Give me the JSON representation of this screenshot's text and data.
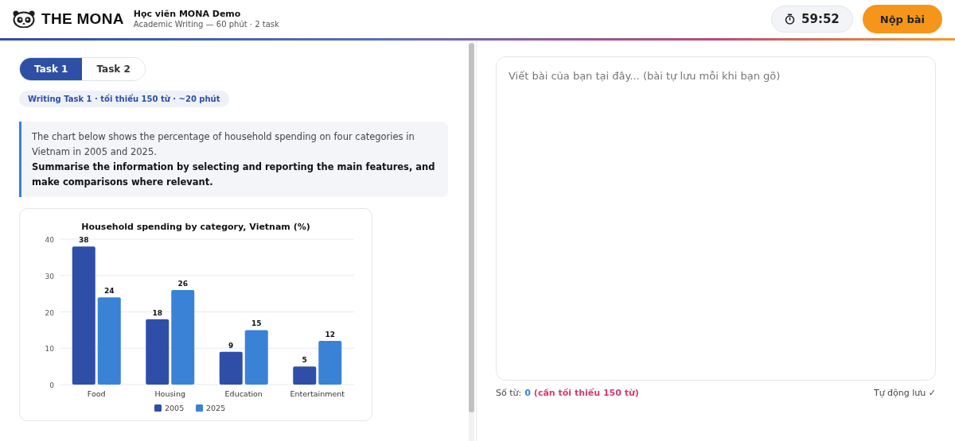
{
  "header": {
    "brand": "THE MONA",
    "title": "Học viên MONA Demo",
    "subtitle": "Academic Writing — 60 phút · 2 task",
    "timer": "59:52",
    "submit": "Nộp bài"
  },
  "tabs": [
    {
      "label": "Task 1",
      "selected": true
    },
    {
      "label": "Task 2",
      "selected": false
    }
  ],
  "task_badge": "Writing Task 1 · tối thiểu 150 từ · ~20 phút",
  "prompt": {
    "text": "The chart below shows the percentage of household spending on four categories in Vietnam in 2005 and 2025.",
    "instruction": "Summarise the information by selecting and reporting the main features, and make comparisons where relevant."
  },
  "chart_data": {
    "type": "bar",
    "title": "Household spending by category, Vietnam (%)",
    "categories": [
      "Food",
      "Housing",
      "Education",
      "Entertainment"
    ],
    "series": [
      {
        "name": "2005",
        "color": "#2f4ea8",
        "values": [
          38,
          18,
          9,
          5
        ]
      },
      {
        "name": "2025",
        "color": "#3a82d6",
        "values": [
          24,
          26,
          15,
          12
        ]
      }
    ],
    "ylim": [
      0,
      40
    ],
    "yticks": [
      0,
      10,
      20,
      30,
      40
    ],
    "data_labels": true,
    "grid": true,
    "legend": true
  },
  "editor": {
    "placeholder": "Viết bài của bạn tại đây... (bài tự lưu mỗi khi bạn gõ)"
  },
  "footer": {
    "count_label": "Số từ:",
    "count": "0",
    "requirement": "(cần tối thiểu 150 từ)",
    "autosave": "Tự động lưu ✓"
  }
}
